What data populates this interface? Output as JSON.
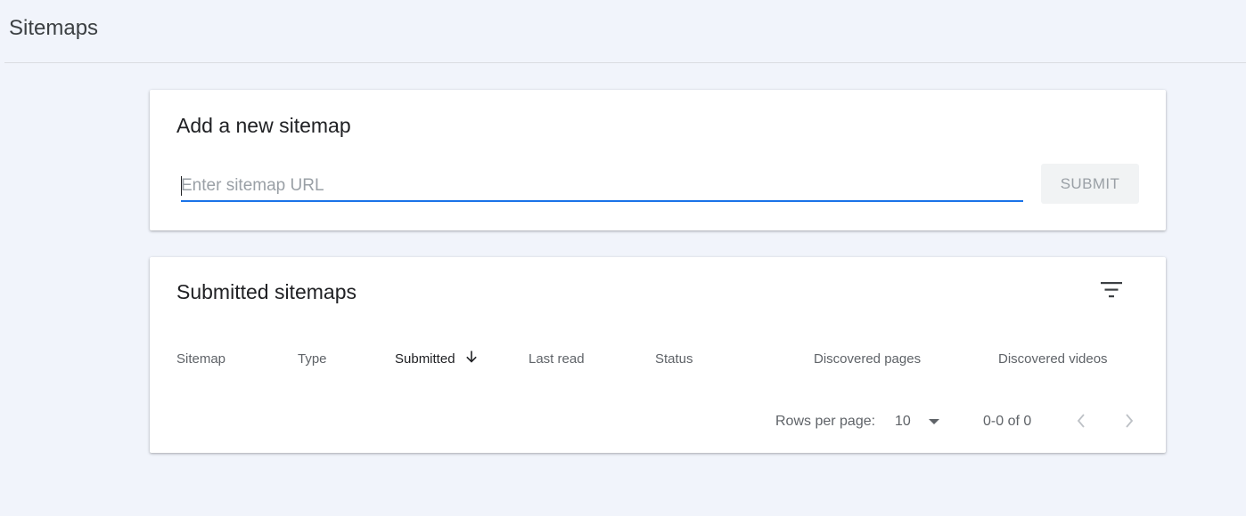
{
  "header": {
    "title": "Sitemaps"
  },
  "add_sitemap": {
    "title": "Add a new sitemap",
    "url_input": {
      "value": "",
      "placeholder": "Enter sitemap URL"
    },
    "submit_label": "SUBMIT"
  },
  "submitted_sitemaps": {
    "title": "Submitted sitemaps",
    "filter_icon": "filter-list-icon",
    "columns": [
      {
        "label": "Sitemap"
      },
      {
        "label": "Type"
      },
      {
        "label": "Submitted",
        "sorted": "descending"
      },
      {
        "label": "Last read"
      },
      {
        "label": "Status"
      },
      {
        "label": "Discovered pages"
      },
      {
        "label": "Discovered videos"
      }
    ],
    "rows": [],
    "pagination": {
      "rows_per_page_label": "Rows per page:",
      "rows_per_page_value": "10",
      "range_label": "0-0 of 0",
      "prev_icon": "chevron-left-icon",
      "next_icon": "chevron-right-icon"
    }
  },
  "colors": {
    "background": "#f1f4fb",
    "accent": "#1a73e8",
    "card": "#ffffff",
    "disabled_button_bg": "#f1f3f4",
    "disabled_text": "#9aa0a6"
  }
}
